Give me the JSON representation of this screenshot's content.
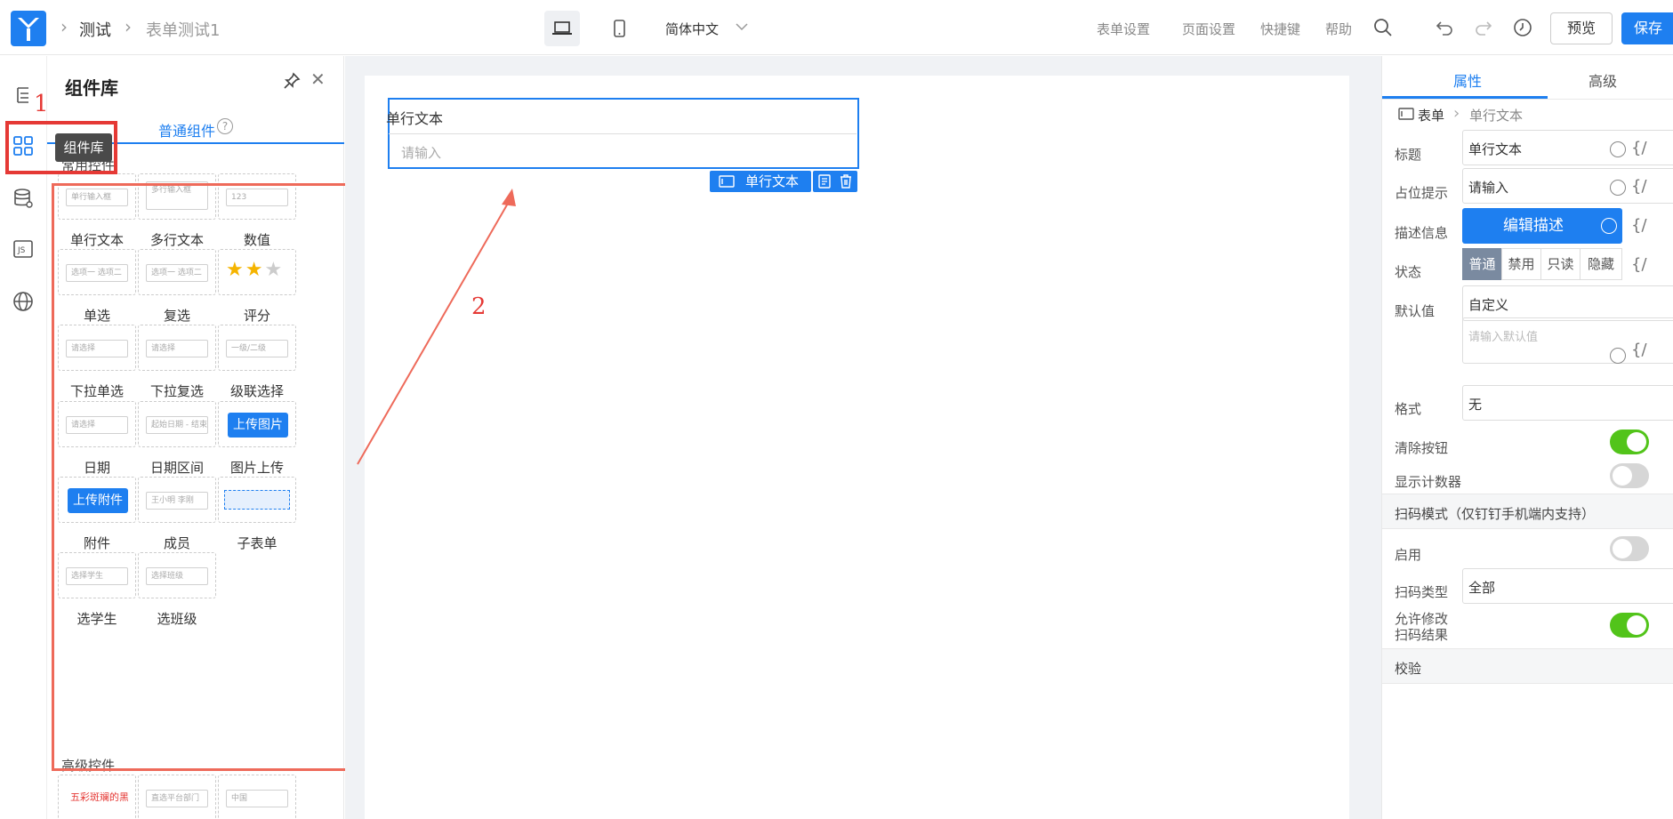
{
  "header": {
    "breadcrumb": [
      "测试",
      "表单测试1"
    ],
    "language": "简体中文",
    "menu": [
      "表单设置",
      "页面设置",
      "快捷键",
      "帮助"
    ],
    "preview_label": "预览",
    "save_label": "保存"
  },
  "panel": {
    "title": "组件库",
    "tab": "普通组件",
    "help_glyph": "?",
    "group_common": "常用控件",
    "group_advanced": "高级控件",
    "tooltip": "组件库",
    "components": [
      {
        "label": "单行文本",
        "preview": "单行输入框"
      },
      {
        "label": "多行文本",
        "preview": "多行输入框"
      },
      {
        "label": "数值",
        "preview": "123"
      },
      {
        "label": "单选",
        "preview": "选项一 选项二"
      },
      {
        "label": "复选",
        "preview": "选项一 选项二"
      },
      {
        "label": "评分",
        "preview": ""
      },
      {
        "label": "下拉单选",
        "preview": "请选择"
      },
      {
        "label": "下拉复选",
        "preview": "请选择"
      },
      {
        "label": "级联选择",
        "preview": "一级/二级"
      },
      {
        "label": "日期",
        "preview": "请选择"
      },
      {
        "label": "日期区间",
        "preview": "起始日期 - 结束日期"
      },
      {
        "label": "图片上传",
        "preview": "上传图片"
      },
      {
        "label": "附件",
        "preview": "上传附件"
      },
      {
        "label": "成员",
        "preview": "王小明 李刚"
      },
      {
        "label": "子表单",
        "preview": ""
      },
      {
        "label": "选学生",
        "preview": "选择学生"
      },
      {
        "label": "选班级",
        "preview": "选择班级"
      }
    ],
    "advanced_previews": [
      "五彩斑斓的黑",
      "直选平台部门",
      "中国"
    ]
  },
  "annotations": {
    "one": "1",
    "two": "2"
  },
  "canvas": {
    "field_label": "单行文本",
    "field_placeholder": "请输入",
    "tag_label": "单行文本"
  },
  "props": {
    "tabs": [
      "属性",
      "高级"
    ],
    "breadcrumb": [
      "表单",
      "单行文本"
    ],
    "title_label": "标题",
    "title_value": "单行文本",
    "placeholder_label": "占位提示",
    "placeholder_value": "请输入",
    "desc_label": "描述信息",
    "desc_button": "编辑描述",
    "state_label": "状态",
    "states": [
      "普通",
      "禁用",
      "只读",
      "隐藏"
    ],
    "default_label": "默认值",
    "default_mode": "自定义",
    "default_placeholder": "请输入默认值",
    "format_label": "格式",
    "format_value": "无",
    "clear_label": "清除按钮",
    "counter_label": "显示计数器",
    "scan_section": "扫码模式（仅钉钉手机端内支持）",
    "enable_label": "启用",
    "scan_type_label": "扫码类型",
    "scan_type_value": "全部",
    "allow_edit_label_1": "允许修改",
    "allow_edit_label_2": "扫码结果",
    "validate_section": "校验",
    "brace": "{/"
  },
  "colors": {
    "accent": "#1e7ff0",
    "toggle_on": "#52c41a",
    "annotation": "#e53935"
  }
}
